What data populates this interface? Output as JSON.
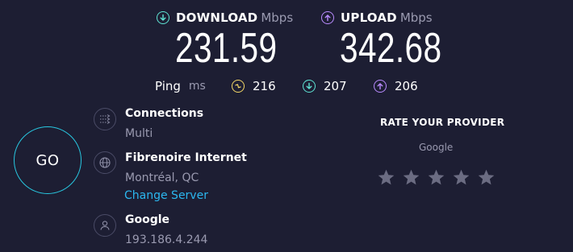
{
  "download": {
    "label": "DOWNLOAD",
    "unit": "Mbps",
    "value": "231.59"
  },
  "upload": {
    "label": "UPLOAD",
    "unit": "Mbps",
    "value": "342.68"
  },
  "ping": {
    "label": "Ping",
    "unit": "ms",
    "idle": "216",
    "download": "207",
    "upload": "206"
  },
  "go_label": "GO",
  "connections": {
    "title": "Connections",
    "value": "Multi"
  },
  "server": {
    "name": "Fibrenoire Internet",
    "location": "Montréal, QC",
    "change_label": "Change Server"
  },
  "provider": {
    "name": "Google",
    "ip": "193.186.4.244"
  },
  "rate": {
    "title": "RATE YOUR PROVIDER",
    "provider": "Google",
    "stars_total": 5,
    "stars_selected": 0
  },
  "colors": {
    "background": "#1d1e33",
    "download_accent": "#5fe4d4",
    "upload_accent": "#b98bff",
    "idle_ping_accent": "#f5d867",
    "go_ring": "#28c7e0",
    "link": "#2bb7ef"
  },
  "icons": {
    "download": "arrow-down-circle-icon",
    "upload": "arrow-up-circle-icon",
    "idle_ping": "lightning-circle-icon",
    "connections": "connections-icon",
    "server": "globe-icon",
    "provider": "user-icon",
    "star": "star-icon"
  }
}
